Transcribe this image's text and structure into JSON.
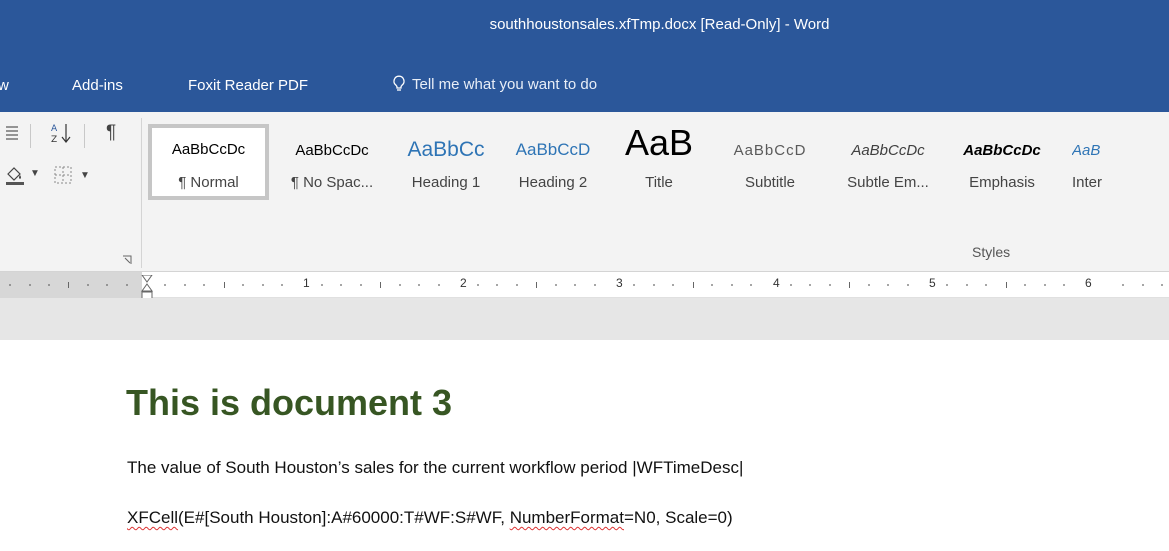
{
  "window": {
    "title": "southhoustonsales.xfTmp.docx [Read-Only]  -  Word"
  },
  "ribbon_tabs": [
    {
      "label": "w"
    },
    {
      "label": "Add-ins"
    },
    {
      "label": "Foxit Reader PDF"
    }
  ],
  "tell_me": {
    "placeholder": "Tell me what you want to do"
  },
  "styles_gallery": [
    {
      "preview": "AaBbCcDc",
      "name": "¶ Normal",
      "selected": true
    },
    {
      "preview": "AaBbCcDc",
      "name": "¶ No Spac..."
    },
    {
      "preview": "AaBbCc",
      "name": "Heading 1"
    },
    {
      "preview": "AaBbCcD",
      "name": "Heading 2"
    },
    {
      "preview": "AaB",
      "name": "Title"
    },
    {
      "preview": "AaBbCcD",
      "name": "Subtitle"
    },
    {
      "preview": "AaBbCcDc",
      "name": "Subtle Em..."
    },
    {
      "preview": "AaBbCcDc",
      "name": "Emphasis"
    },
    {
      "preview": "AaB",
      "name": "Inter"
    }
  ],
  "styles_group_label": "Styles",
  "ruler_numbers": [
    "1",
    "2",
    "3",
    "4",
    "5",
    "6"
  ],
  "document": {
    "heading": "This is document 3",
    "line1": "The value of South Houston’s sales for the current workflow period |WFTimeDesc|",
    "line2_part1": "XFCell",
    "line2_part2": "(E#[South Houston]:A#60000:T#WF:S#WF, ",
    "line2_part3": "NumberFormat",
    "line2_part4": "=N0, Scale=0)"
  },
  "colors": {
    "accent": "#2b579a",
    "heading": "#375623"
  }
}
